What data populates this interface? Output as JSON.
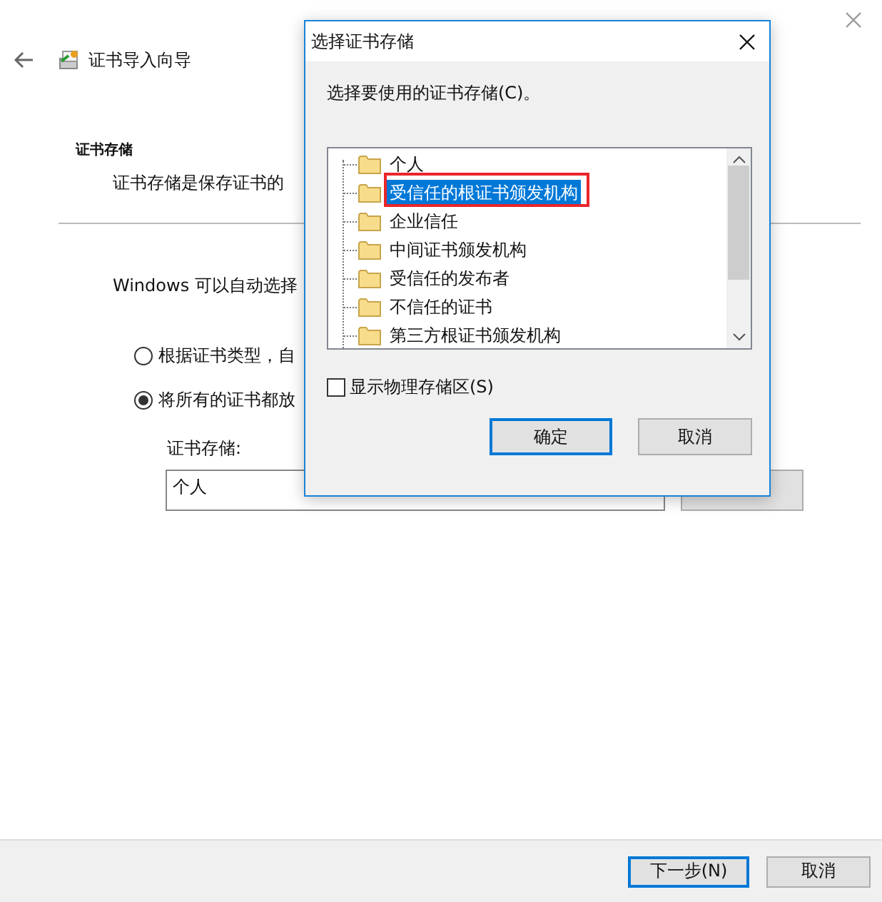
{
  "wizard": {
    "title": "证书导入向导",
    "section_heading": "证书存储",
    "description": "证书存储是保存证书的",
    "auto_text": "Windows 可以自动选择",
    "options": [
      {
        "label": "根据证书类型，自",
        "selected": false
      },
      {
        "label": "将所有的证书都放",
        "selected": true
      }
    ],
    "store_label": "证书存储:",
    "store_value": "个人",
    "buttons": [
      {
        "label": "下一步(N)",
        "default": true
      },
      {
        "label": "取消",
        "default": false
      }
    ]
  },
  "dialog": {
    "title": "选择证书存储",
    "prompt": "选择要使用的证书存储(C)。",
    "stores": [
      {
        "label": "个人",
        "selected": false
      },
      {
        "label": "受信任的根证书颁发机构",
        "selected": true
      },
      {
        "label": "企业信任",
        "selected": false
      },
      {
        "label": "中间证书颁发机构",
        "selected": false
      },
      {
        "label": "受信任的发布者",
        "selected": false
      },
      {
        "label": "不信任的证书",
        "selected": false
      },
      {
        "label": "第三方根证书颁发机构",
        "selected": false
      }
    ],
    "show_physical": {
      "label": "显示物理存储区(S)",
      "checked": false
    },
    "buttons": [
      {
        "label": "确定",
        "default": true
      },
      {
        "label": "取消",
        "default": false
      }
    ]
  }
}
